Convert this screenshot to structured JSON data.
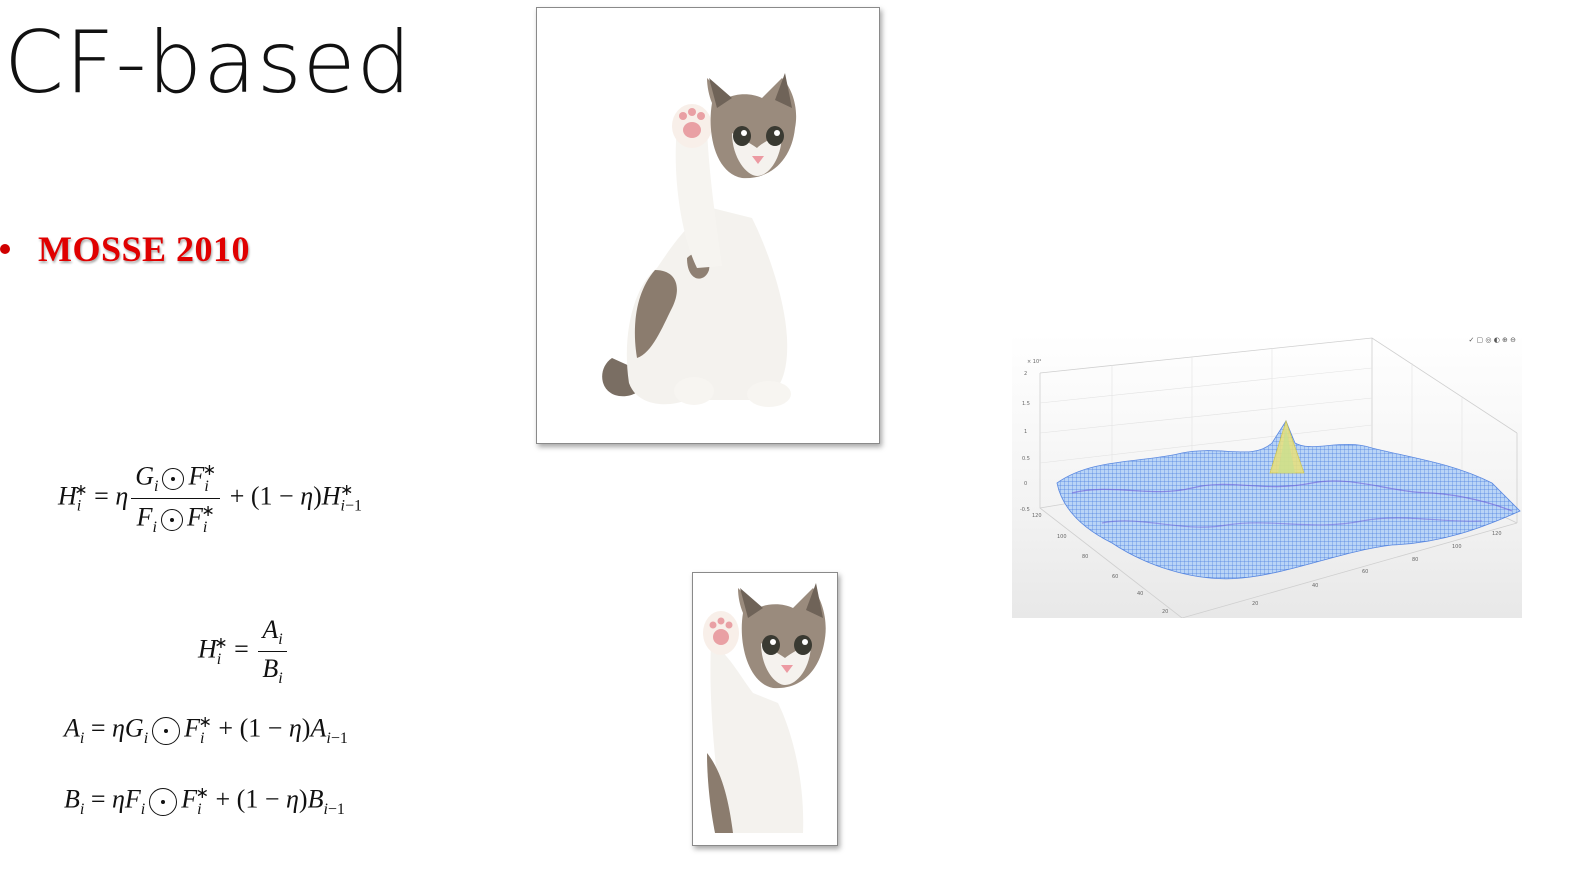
{
  "title": "CF-based",
  "bullet": {
    "text": "MOSSE 2010",
    "color": "#e00000"
  },
  "images": {
    "large_photo": "kitten-raising-paw-full",
    "small_photo": "kitten-raising-paw-cropped",
    "plot": "3d-correlation-response-surface"
  },
  "colors": {
    "bullet_red": "#e00000",
    "mesh_blue": "#4a7fe0",
    "peak_yellow": "#e8d44a"
  }
}
